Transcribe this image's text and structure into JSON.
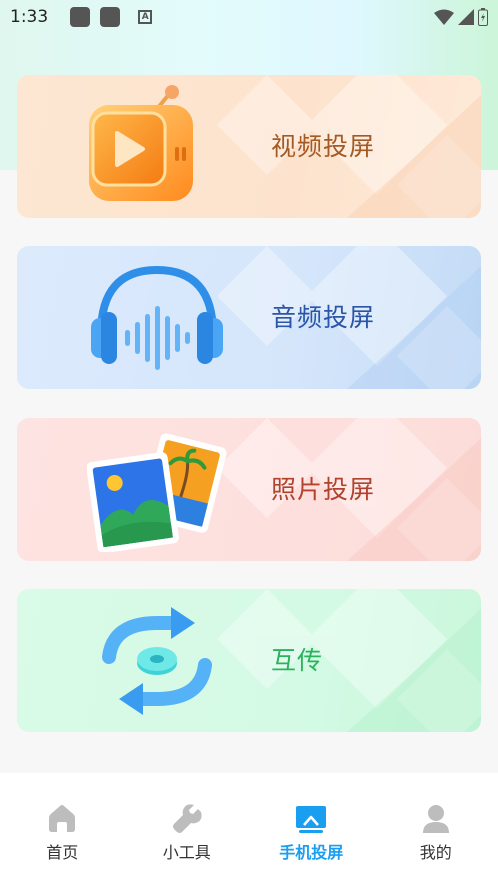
{
  "status_bar": {
    "time": "1:33"
  },
  "cards": [
    {
      "label": "视频投屏",
      "icon": "video-play-icon"
    },
    {
      "label": "音频投屏",
      "icon": "headphones-icon"
    },
    {
      "label": "照片投屏",
      "icon": "photo-icon"
    },
    {
      "label": "互传",
      "icon": "transfer-sync-icon"
    }
  ],
  "nav": {
    "items": [
      {
        "label": "首页",
        "icon": "home-icon"
      },
      {
        "label": "小工具",
        "icon": "wrench-icon"
      },
      {
        "label": "手机投屏",
        "icon": "cast-screen-icon",
        "active": true
      },
      {
        "label": "我的",
        "icon": "user-icon"
      }
    ],
    "active_color": "#1a9ef0"
  }
}
